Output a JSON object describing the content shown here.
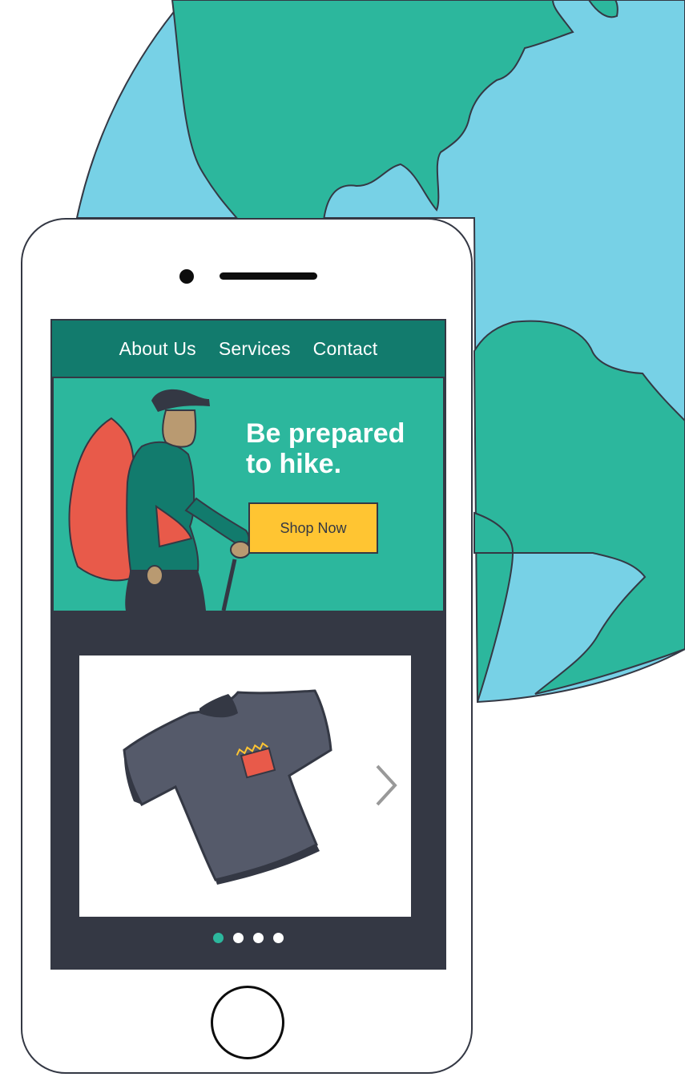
{
  "nav": {
    "items": [
      {
        "label": "About Us"
      },
      {
        "label": "Services"
      },
      {
        "label": "Contact"
      }
    ]
  },
  "hero": {
    "headline_line1": "Be prepared",
    "headline_line2": "to hike.",
    "cta_label": "Shop Now"
  },
  "product_card": {
    "icon": "tshirt-icon",
    "next": "chevron-right-icon"
  },
  "carousel": {
    "total": 4,
    "active_index": 0
  },
  "colors": {
    "ocean": "#77d1e6",
    "land": "#2cb79d",
    "nav": "#127b6d",
    "dark": "#343844",
    "accent": "#ffc532",
    "backpack": "#e85a4a",
    "skin": "#b99a71"
  }
}
